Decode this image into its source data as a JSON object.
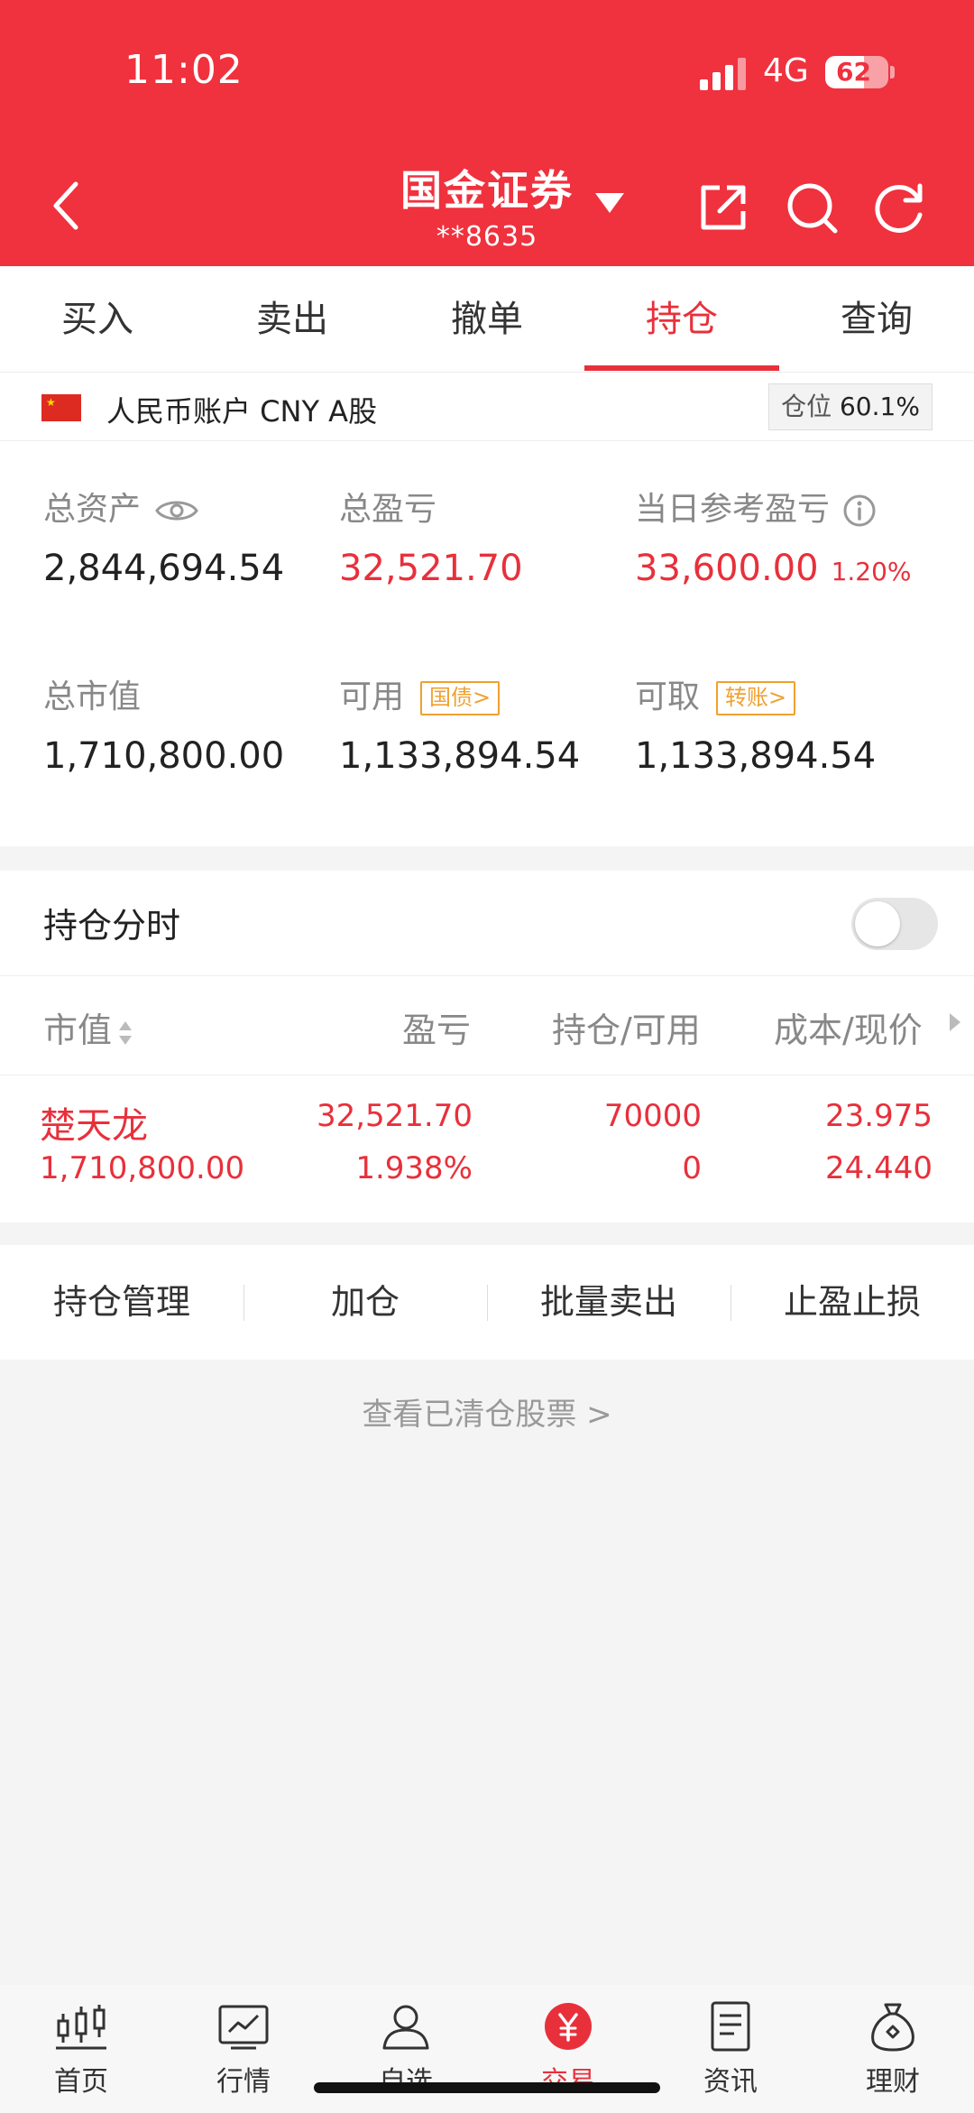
{
  "status_bar": {
    "time": "11:02",
    "network": "4G",
    "battery": "62"
  },
  "header": {
    "title": "国金证券",
    "account_masked": "**8635"
  },
  "tabs": [
    {
      "label": "买入"
    },
    {
      "label": "卖出"
    },
    {
      "label": "撤单"
    },
    {
      "label": "持仓",
      "active": true
    },
    {
      "label": "查询"
    }
  ],
  "account": {
    "label": "人民币账户 CNY A股",
    "position_label": "仓位",
    "position_value": "60.1%"
  },
  "summary": {
    "total_assets_label": "总资产",
    "total_assets": "2,844,694.54",
    "total_pl_label": "总盈亏",
    "total_pl": "32,521.70",
    "daily_pl_label": "当日参考盈亏",
    "daily_pl": "33,600.00",
    "daily_pl_pct": "1.20%",
    "market_value_label": "总市值",
    "market_value": "1,710,800.00",
    "available_label": "可用",
    "available_chip": "国债>",
    "available": "1,133,894.54",
    "withdrawable_label": "可取",
    "withdrawable_chip": "转账>",
    "withdrawable": "1,133,894.54"
  },
  "holdings": {
    "title": "持仓分时",
    "columns": [
      "市值",
      "盈亏",
      "持仓/可用",
      "成本/现价"
    ],
    "rows": [
      {
        "name": "楚天龙",
        "market_value": "1,710,800.00",
        "pl": "32,521.70",
        "pl_pct": "1.938%",
        "position": "70000",
        "available": "0",
        "cost": "23.975",
        "price": "24.440"
      }
    ]
  },
  "actions": [
    "持仓管理",
    "加仓",
    "批量卖出",
    "止盈止损"
  ],
  "cleared_link": "查看已清仓股票 >",
  "bottom_nav": [
    {
      "label": "首页",
      "icon": "candlestick-icon"
    },
    {
      "label": "行情",
      "icon": "chart-icon"
    },
    {
      "label": "自选",
      "icon": "user-icon"
    },
    {
      "label": "交易",
      "icon": "yuan-icon",
      "active": true
    },
    {
      "label": "资讯",
      "icon": "document-icon"
    },
    {
      "label": "理财",
      "icon": "moneybag-icon"
    }
  ],
  "colors": {
    "brand": "#f0313e",
    "up": "#e8303b",
    "chip": "#f0a030"
  }
}
